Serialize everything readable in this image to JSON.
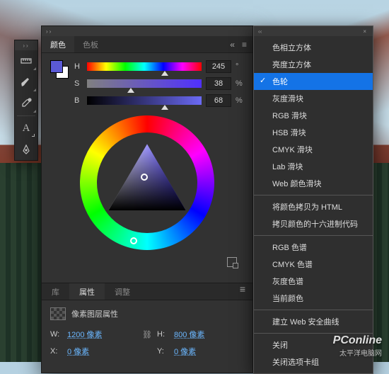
{
  "watermark": {
    "brand": "PConline",
    "sub": "太平洋电脑网"
  },
  "toolstrip": {
    "tools": [
      "ruler",
      "brush",
      "eyedropper",
      "type",
      "pen"
    ]
  },
  "panel": {
    "tabs": {
      "color": "颜色",
      "swatches": "色板"
    },
    "hsb": {
      "h_label": "H",
      "h_value": "245",
      "h_unit": "°",
      "s_label": "S",
      "s_value": "38",
      "s_unit": "%",
      "b_label": "B",
      "b_value": "68",
      "b_unit": "%"
    },
    "subtabs": {
      "lib": "库",
      "props": "属性",
      "adjust": "调整"
    },
    "props": {
      "title": "像素图层属性",
      "w_label": "W:",
      "w_value": "1200 像素",
      "h_label": "H:",
      "h_value": "800 像素",
      "x_label": "X:",
      "x_value": "0 像素",
      "y_label": "Y:",
      "y_value": "0 像素"
    }
  },
  "menu": {
    "items": [
      "色相立方体",
      "亮度立方体",
      "色轮",
      "灰度滑块",
      "RGB 滑块",
      "HSB 滑块",
      "CMYK 滑块",
      "Lab 滑块",
      "Web 颜色滑块"
    ],
    "group2": [
      "将颜色拷贝为 HTML",
      "拷贝颜色的十六进制代码"
    ],
    "group3": [
      "RGB 色谱",
      "CMYK 色谱",
      "灰度色谱",
      "当前颜色"
    ],
    "group4": [
      "建立 Web 安全曲线"
    ],
    "group5": [
      "关闭",
      "关闭选项卡组"
    ],
    "selected": "色轮"
  }
}
